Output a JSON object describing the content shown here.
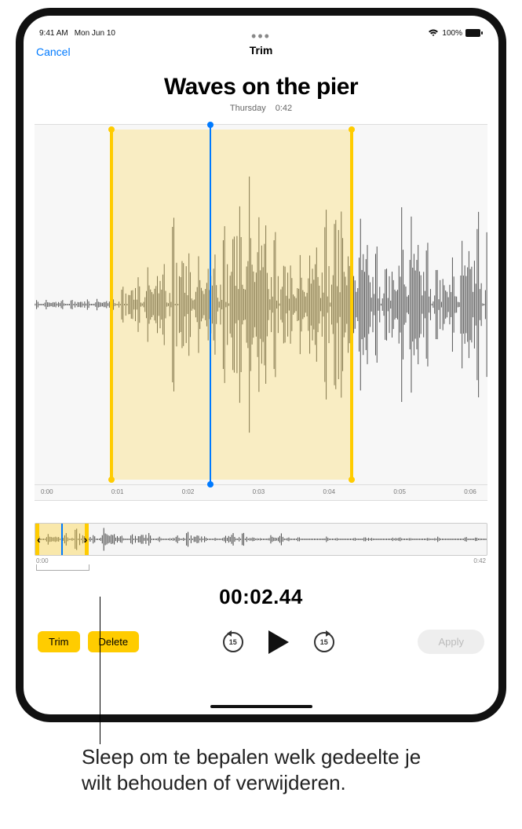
{
  "status": {
    "time": "9:41 AM",
    "date": "Mon Jun 10",
    "battery": "100%"
  },
  "nav": {
    "cancel": "Cancel",
    "title": "Trim"
  },
  "recording": {
    "title": "Waves on the pier",
    "day": "Thursday",
    "duration": "0:42"
  },
  "ruler": {
    "t0": "0:00",
    "t1": "0:01",
    "t2": "0:02",
    "t3": "0:03",
    "t4": "0:04",
    "t5": "0:05",
    "t6": "0:06"
  },
  "overview": {
    "start": "0:00",
    "end": "0:42"
  },
  "playhead_time": "00:02.44",
  "buttons": {
    "trim": "Trim",
    "delete": "Delete",
    "apply": "Apply",
    "skip_value": "15"
  },
  "colors": {
    "accent_yellow": "#ffcc00",
    "accent_blue": "#007aff"
  },
  "caption": "Sleep om te bepalen welk gedeelte je wilt behouden of verwijderen."
}
